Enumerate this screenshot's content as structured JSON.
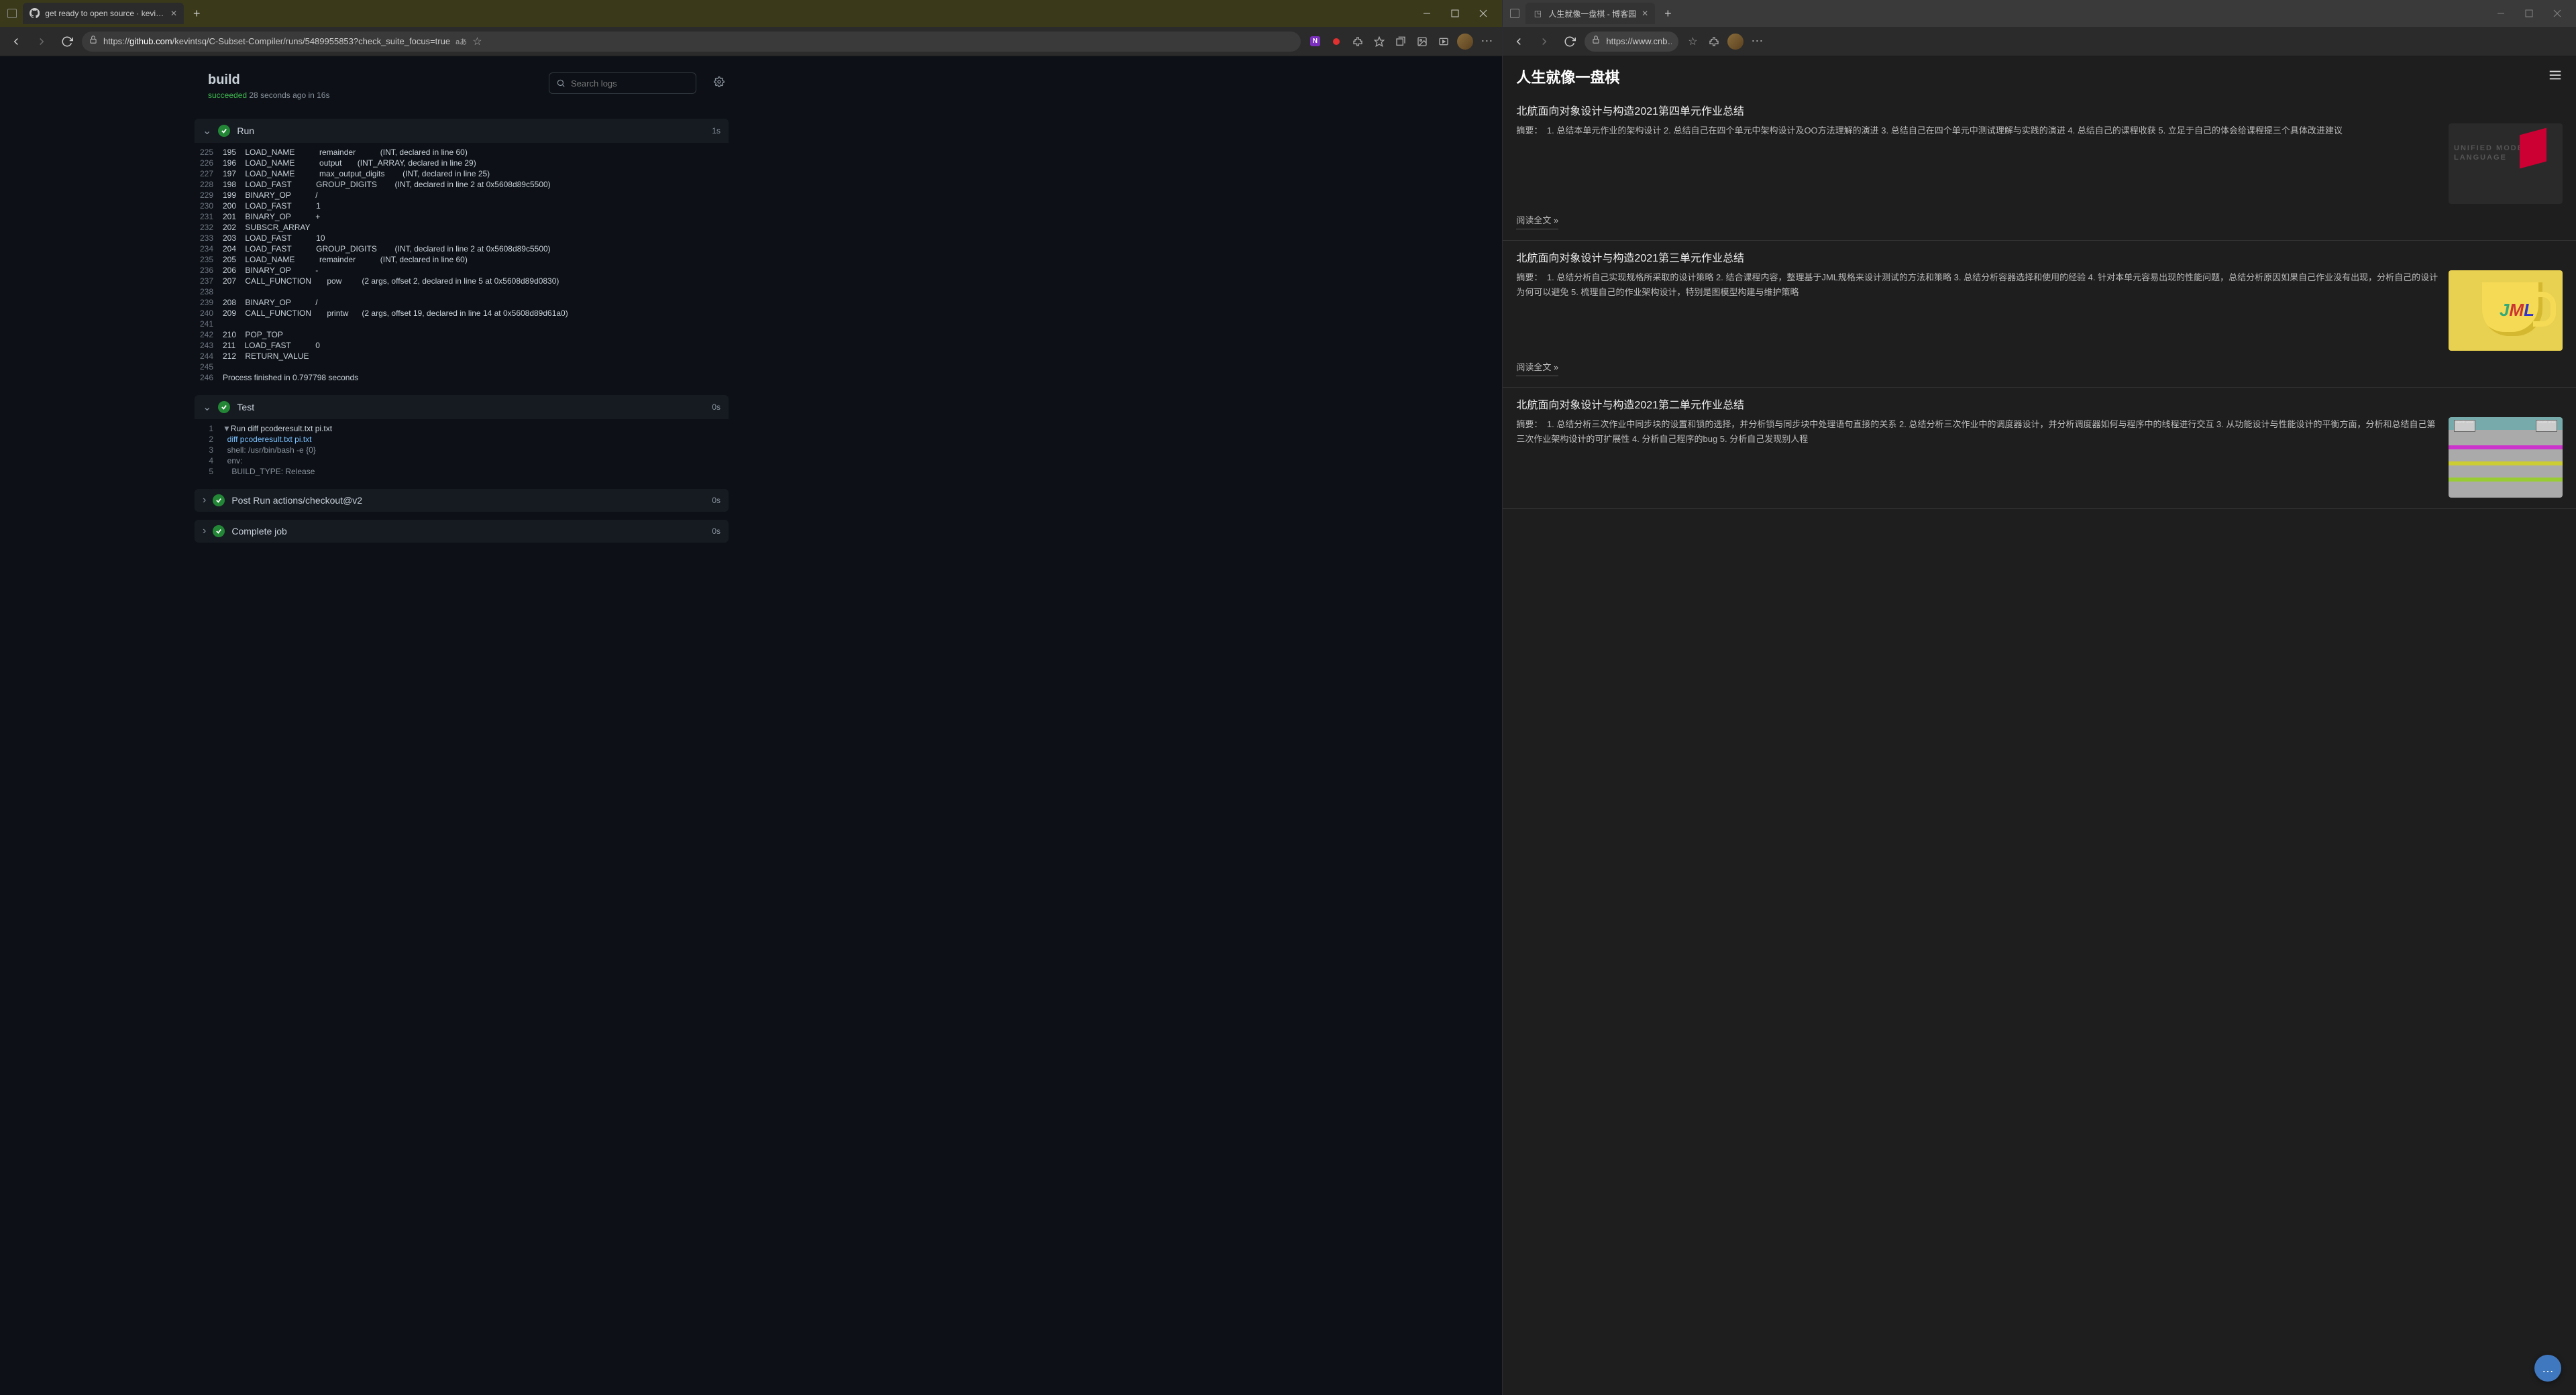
{
  "left": {
    "tab_title": "get ready to open source · kevint…",
    "url_pre": "https://",
    "url_dom": "github.com",
    "url_path": "/kevintsq/C-Subset-Compiler/runs/5489955853?check_suite_focus=true",
    "header_title": "build",
    "header_sub_status": "succeeded",
    "header_sub_rest": " 28 seconds ago in 16s",
    "search_placeholder": "Search logs",
    "steps": {
      "run": {
        "name": "Run",
        "time": "1s"
      },
      "test": {
        "name": "Test",
        "time": "0s"
      },
      "postrun": {
        "name": "Post Run actions/checkout@v2",
        "time": "0s"
      },
      "complete": {
        "name": "Complete job",
        "time": "0s"
      }
    },
    "run_log": [
      {
        "n": "225",
        "t": "195    LOAD_NAME           remainder           (INT, declared in line 60)"
      },
      {
        "n": "226",
        "t": "196    LOAD_NAME           output       (INT_ARRAY, declared in line 29)"
      },
      {
        "n": "227",
        "t": "197    LOAD_NAME           max_output_digits        (INT, declared in line 25)"
      },
      {
        "n": "228",
        "t": "198    LOAD_FAST           GROUP_DIGITS        (INT, declared in line 2 at 0x5608d89c5500)"
      },
      {
        "n": "229",
        "t": "199    BINARY_OP           /"
      },
      {
        "n": "230",
        "t": "200    LOAD_FAST           1"
      },
      {
        "n": "231",
        "t": "201    BINARY_OP           +"
      },
      {
        "n": "232",
        "t": "202    SUBSCR_ARRAY"
      },
      {
        "n": "233",
        "t": "203    LOAD_FAST           10"
      },
      {
        "n": "234",
        "t": "204    LOAD_FAST           GROUP_DIGITS        (INT, declared in line 2 at 0x5608d89c5500)"
      },
      {
        "n": "235",
        "t": "205    LOAD_NAME           remainder           (INT, declared in line 60)"
      },
      {
        "n": "236",
        "t": "206    BINARY_OP           -"
      },
      {
        "n": "237",
        "t": "207    CALL_FUNCTION       pow         (2 args, offset 2, declared in line 5 at 0x5608d89d0830)"
      },
      {
        "n": "238",
        "t": ""
      },
      {
        "n": "239",
        "t": "208    BINARY_OP           /"
      },
      {
        "n": "240",
        "t": "209    CALL_FUNCTION       printw      (2 args, offset 19, declared in line 14 at 0x5608d89d61a0)"
      },
      {
        "n": "241",
        "t": ""
      },
      {
        "n": "242",
        "t": "210    POP_TOP"
      },
      {
        "n": "243",
        "t": "211    LOAD_FAST           0"
      },
      {
        "n": "244",
        "t": "212    RETURN_VALUE"
      },
      {
        "n": "245",
        "t": ""
      },
      {
        "n": "246",
        "t": "Process finished in 0.797798 seconds"
      }
    ],
    "test_log": [
      {
        "n": "1",
        "cls": "",
        "pre": "▼",
        "t": "Run diff pcoderesult.txt pi.txt"
      },
      {
        "n": "2",
        "cls": "cmd",
        "pre": "  ",
        "t": "diff pcoderesult.txt pi.txt"
      },
      {
        "n": "3",
        "cls": "muted",
        "pre": "  ",
        "t": "shell: /usr/bin/bash -e {0}"
      },
      {
        "n": "4",
        "cls": "muted",
        "pre": "  ",
        "t": "env:"
      },
      {
        "n": "5",
        "cls": "muted",
        "pre": "    ",
        "t": "BUILD_TYPE: Release"
      }
    ]
  },
  "right": {
    "tab_title": "人生就像一盘棋 - 博客园",
    "url": "https://www.cnb…",
    "blog_title": "人生就像一盘棋",
    "readmore": "阅读全文 »",
    "fab": "…",
    "posts": [
      {
        "title": "北航面向对象设计与构造2021第四单元作业总结",
        "excerpt": "摘要：　1. 总结本单元作业的架构设计 2. 总结自己在四个单元中架构设计及OO方法理解的演进 3. 总结自己在四个单元中测试理解与实践的演进 4. 总结自己的课程收获 5. 立足于自己的体会给课程提三个具体改进建议",
        "thumb": "uml"
      },
      {
        "title": "北航面向对象设计与构造2021第三单元作业总结",
        "excerpt": "摘要：　1. 总结分析自己实现规格所采取的设计策略 2. 结合课程内容，整理基于JML规格来设计测试的方法和策略 3. 总结分析容器选择和使用的经验 4. 针对本单元容易出现的性能问题，总结分析原因如果自己作业没有出现，分析自己的设计为何可以避免 5. 梳理自己的作业架构设计，特别是图模型构建与维护策略",
        "thumb": "jml"
      },
      {
        "title": "北航面向对象设计与构造2021第二单元作业总结",
        "excerpt": "摘要：　1. 总结分析三次作业中同步块的设置和锁的选择，并分析锁与同步块中处理语句直接的关系 2. 总结分析三次作业中的调度器设计，并分析调度器如何与程序中的线程进行交互 3. 从功能设计与性能设计的平衡方面，分析和总结自己第三次作业架构设计的可扩展性 4. 分析自己程序的bug 5. 分析自己发现别人程",
        "thumb": "map"
      }
    ],
    "uml_text": "UNIFIED\nMODELING\nLANGUAGE"
  }
}
